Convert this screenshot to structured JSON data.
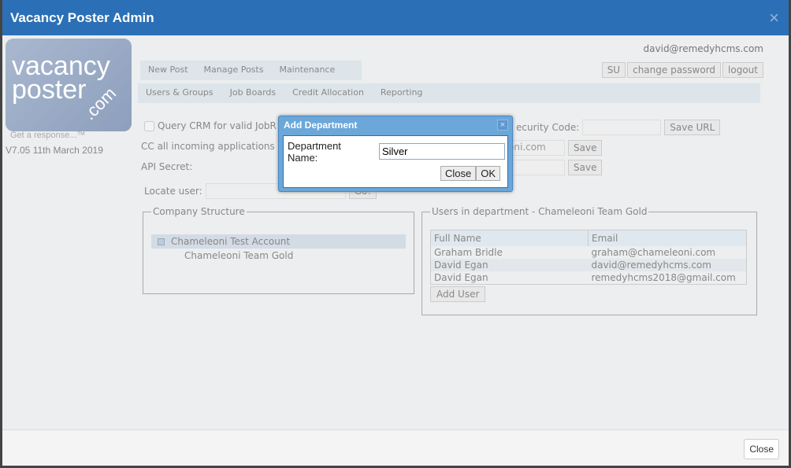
{
  "window": {
    "title": "Vacancy Poster Admin",
    "close_icon": "×"
  },
  "logo": {
    "line1": "vacancy",
    "line2": "poster",
    "suffix": ".com",
    "tagline": "Get a response...™"
  },
  "version": "V7.05 11th March 2019",
  "user_email": "david@remedyhcms.com",
  "top_buttons": [
    "SU",
    "change password",
    "logout"
  ],
  "nav1": [
    "New Post",
    "Manage Posts",
    "Maintenance"
  ],
  "nav2": [
    "Users & Groups",
    "Job Boards",
    "Credit Allocation",
    "Reporting"
  ],
  "form": {
    "query_crm_label": "Query CRM for valid JobR",
    "security_code_label": "ecurity Code:",
    "save_url": "Save URL",
    "cc_label": "CC all incoming applications",
    "cc_value": "oni.com",
    "save": "Save",
    "api_secret_label": "API Secret:",
    "locate_user_label": "Locate user:",
    "go": "Go!"
  },
  "company_structure": {
    "legend": "Company Structure",
    "root": "Chameleoni Test Account",
    "child": "Chameleoni Team Gold"
  },
  "users_panel": {
    "legend": "Users in department - Chameleoni Team Gold",
    "columns": [
      "Full Name",
      "Email"
    ],
    "rows": [
      [
        "Graham Bridle",
        "graham@chameleoni.com"
      ],
      [
        "David Egan",
        "david@remedyhcms.com"
      ],
      [
        "David Egan",
        "remedyhcms2018@gmail.com"
      ]
    ],
    "add_user": "Add User"
  },
  "dialog": {
    "title": "Add Department",
    "close_icon": "×",
    "label_line1": "Department",
    "label_line2": "Name:",
    "value": "Silver",
    "close": "Close",
    "ok": "OK"
  },
  "footer": {
    "close": "Close"
  }
}
